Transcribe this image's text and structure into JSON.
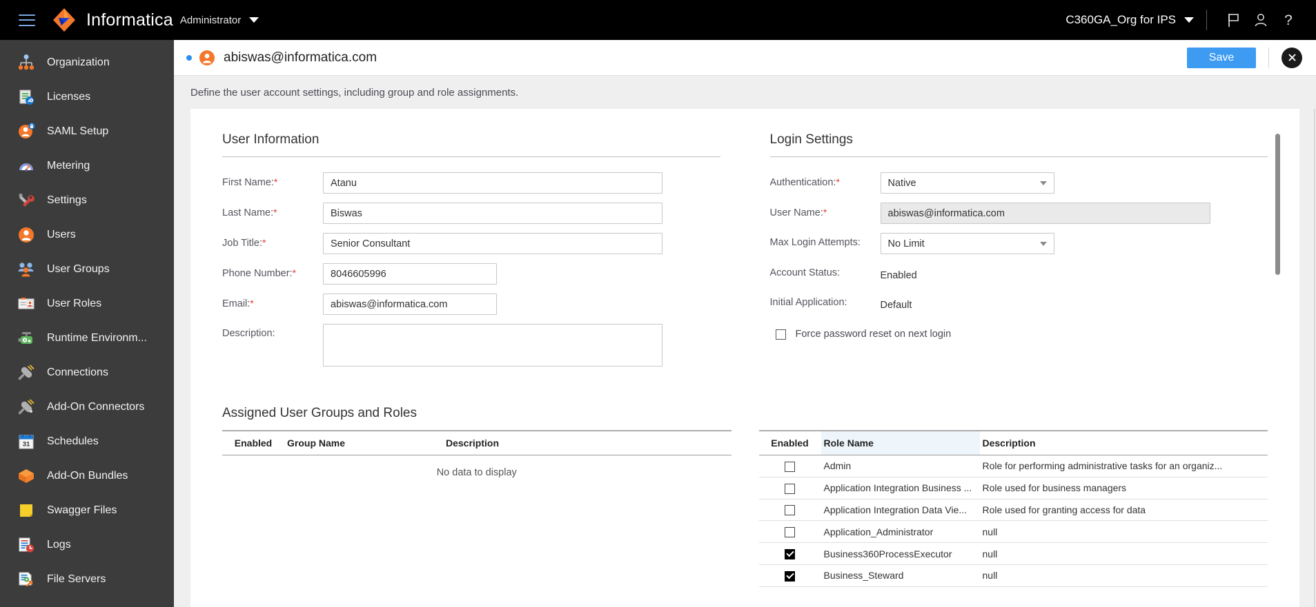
{
  "topbar": {
    "menu_icon": "hamburger-menu-icon",
    "brand": "Informatica",
    "brand_sub": "Administrator",
    "brand_caret": "chevron-down-icon",
    "org_name": "C360GA_Org for IPS",
    "org_caret": "chevron-down-icon",
    "icons": [
      "flag-icon",
      "user-icon",
      "help-icon"
    ]
  },
  "sidebar": {
    "items": [
      {
        "label": "Organization",
        "icon": "organization-icon"
      },
      {
        "label": "Licenses",
        "icon": "license-document-icon"
      },
      {
        "label": "SAML Setup",
        "icon": "saml-user-lock-icon"
      },
      {
        "label": "Metering",
        "icon": "metering-gauge-icon"
      },
      {
        "label": "Settings",
        "icon": "settings-tools-icon"
      },
      {
        "label": "Users",
        "icon": "user-icon"
      },
      {
        "label": "User Groups",
        "icon": "user-groups-icon"
      },
      {
        "label": "User Roles",
        "icon": "user-roles-badge-icon"
      },
      {
        "label": "Runtime Environm...",
        "icon": "runtime-environment-icon"
      },
      {
        "label": "Connections",
        "icon": "connection-plug-icon"
      },
      {
        "label": "Add-On Connectors",
        "icon": "addon-connector-plug-icon"
      },
      {
        "label": "Schedules",
        "icon": "calendar-31-icon"
      },
      {
        "label": "Add-On Bundles",
        "icon": "addon-bundle-box-icon"
      },
      {
        "label": "Swagger Files",
        "icon": "swagger-file-icon"
      },
      {
        "label": "Logs",
        "icon": "logs-clock-icon"
      },
      {
        "label": "File Servers",
        "icon": "file-servers-icon"
      }
    ]
  },
  "page_header": {
    "status_dot": "active-status-dot",
    "avatar_icon": "user-avatar-icon",
    "title": "abiswas@informatica.com",
    "save_label": "Save",
    "close_icon": "close-icon"
  },
  "subheader": {
    "description": "Define the user account settings, including group and role assignments."
  },
  "user_information": {
    "section_title": "User Information",
    "fields": {
      "first_name_label": "First Name:",
      "first_name_value": "Atanu",
      "last_name_label": "Last Name:",
      "last_name_value": "Biswas",
      "job_title_label": "Job Title:",
      "job_title_value": "Senior Consultant",
      "phone_label": "Phone Number:",
      "phone_value": "8046605996",
      "email_label": "Email:",
      "email_value": "abiswas@informatica.com",
      "description_label": "Description:",
      "description_value": ""
    }
  },
  "login_settings": {
    "section_title": "Login Settings",
    "fields": {
      "authentication_label": "Authentication:",
      "authentication_value": "Native",
      "username_label": "User Name:",
      "username_value": "abiswas@informatica.com",
      "max_login_label": "Max Login Attempts:",
      "max_login_value": "No Limit",
      "account_status_label": "Account Status:",
      "account_status_value": "Enabled",
      "initial_application_label": "Initial Application:",
      "initial_application_value": "Default",
      "force_reset_label": "Force password reset on next login",
      "force_reset_checked": false
    }
  },
  "assigned": {
    "section_title": "Assigned User Groups and Roles",
    "groups_table": {
      "headers": [
        "Enabled",
        "Group Name",
        "Description"
      ],
      "rows": [],
      "empty_text": "No data to display"
    },
    "roles_table": {
      "headers": [
        "Enabled",
        "Role Name",
        "Description"
      ],
      "rows": [
        {
          "enabled": false,
          "name": "Admin",
          "description": "Role for performing administrative tasks for an organiz..."
        },
        {
          "enabled": false,
          "name": "Application Integration Business ...",
          "description": "Role used for business managers"
        },
        {
          "enabled": false,
          "name": "Application Integration Data Vie...",
          "description": "Role used for granting access for data"
        },
        {
          "enabled": false,
          "name": "Application_Administrator",
          "description": "null"
        },
        {
          "enabled": true,
          "name": "Business360ProcessExecutor",
          "description": "null"
        },
        {
          "enabled": true,
          "name": "Business_Steward",
          "description": "null"
        }
      ]
    }
  },
  "colors": {
    "brand_orange": "#f4772a",
    "accent_blue": "#3d9bf2",
    "topbar_bg": "#000000",
    "sidebar_bg": "#3c3c3c",
    "required_red": "#e23b2e"
  }
}
